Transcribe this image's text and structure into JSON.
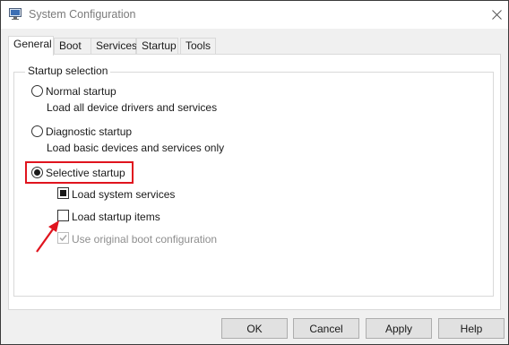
{
  "window": {
    "title": "System Configuration",
    "icon": "system-configuration-icon"
  },
  "tabs": [
    {
      "label": "General",
      "active": true
    },
    {
      "label": "Boot",
      "active": false
    },
    {
      "label": "Services",
      "active": false
    },
    {
      "label": "Startup",
      "active": false
    },
    {
      "label": "Tools",
      "active": false
    }
  ],
  "startup_selection": {
    "legend": "Startup selection",
    "normal": {
      "label": "Normal startup",
      "description": "Load all device drivers and services",
      "selected": false
    },
    "diagnostic": {
      "label": "Diagnostic startup",
      "description": "Load basic devices and services only",
      "selected": false
    },
    "selective": {
      "label": "Selective startup",
      "selected": true
    },
    "options": [
      {
        "label": "Load system services",
        "state": "indeterminate",
        "enabled": true
      },
      {
        "label": "Load startup items",
        "state": "unchecked",
        "enabled": true
      },
      {
        "label": "Use original boot configuration",
        "state": "checked",
        "enabled": false
      }
    ]
  },
  "buttons": {
    "ok": "OK",
    "cancel": "Cancel",
    "apply": "Apply",
    "help": "Help"
  },
  "annotations": {
    "highlight_color": "#e0141e",
    "arrow_color": "#e0141e"
  }
}
